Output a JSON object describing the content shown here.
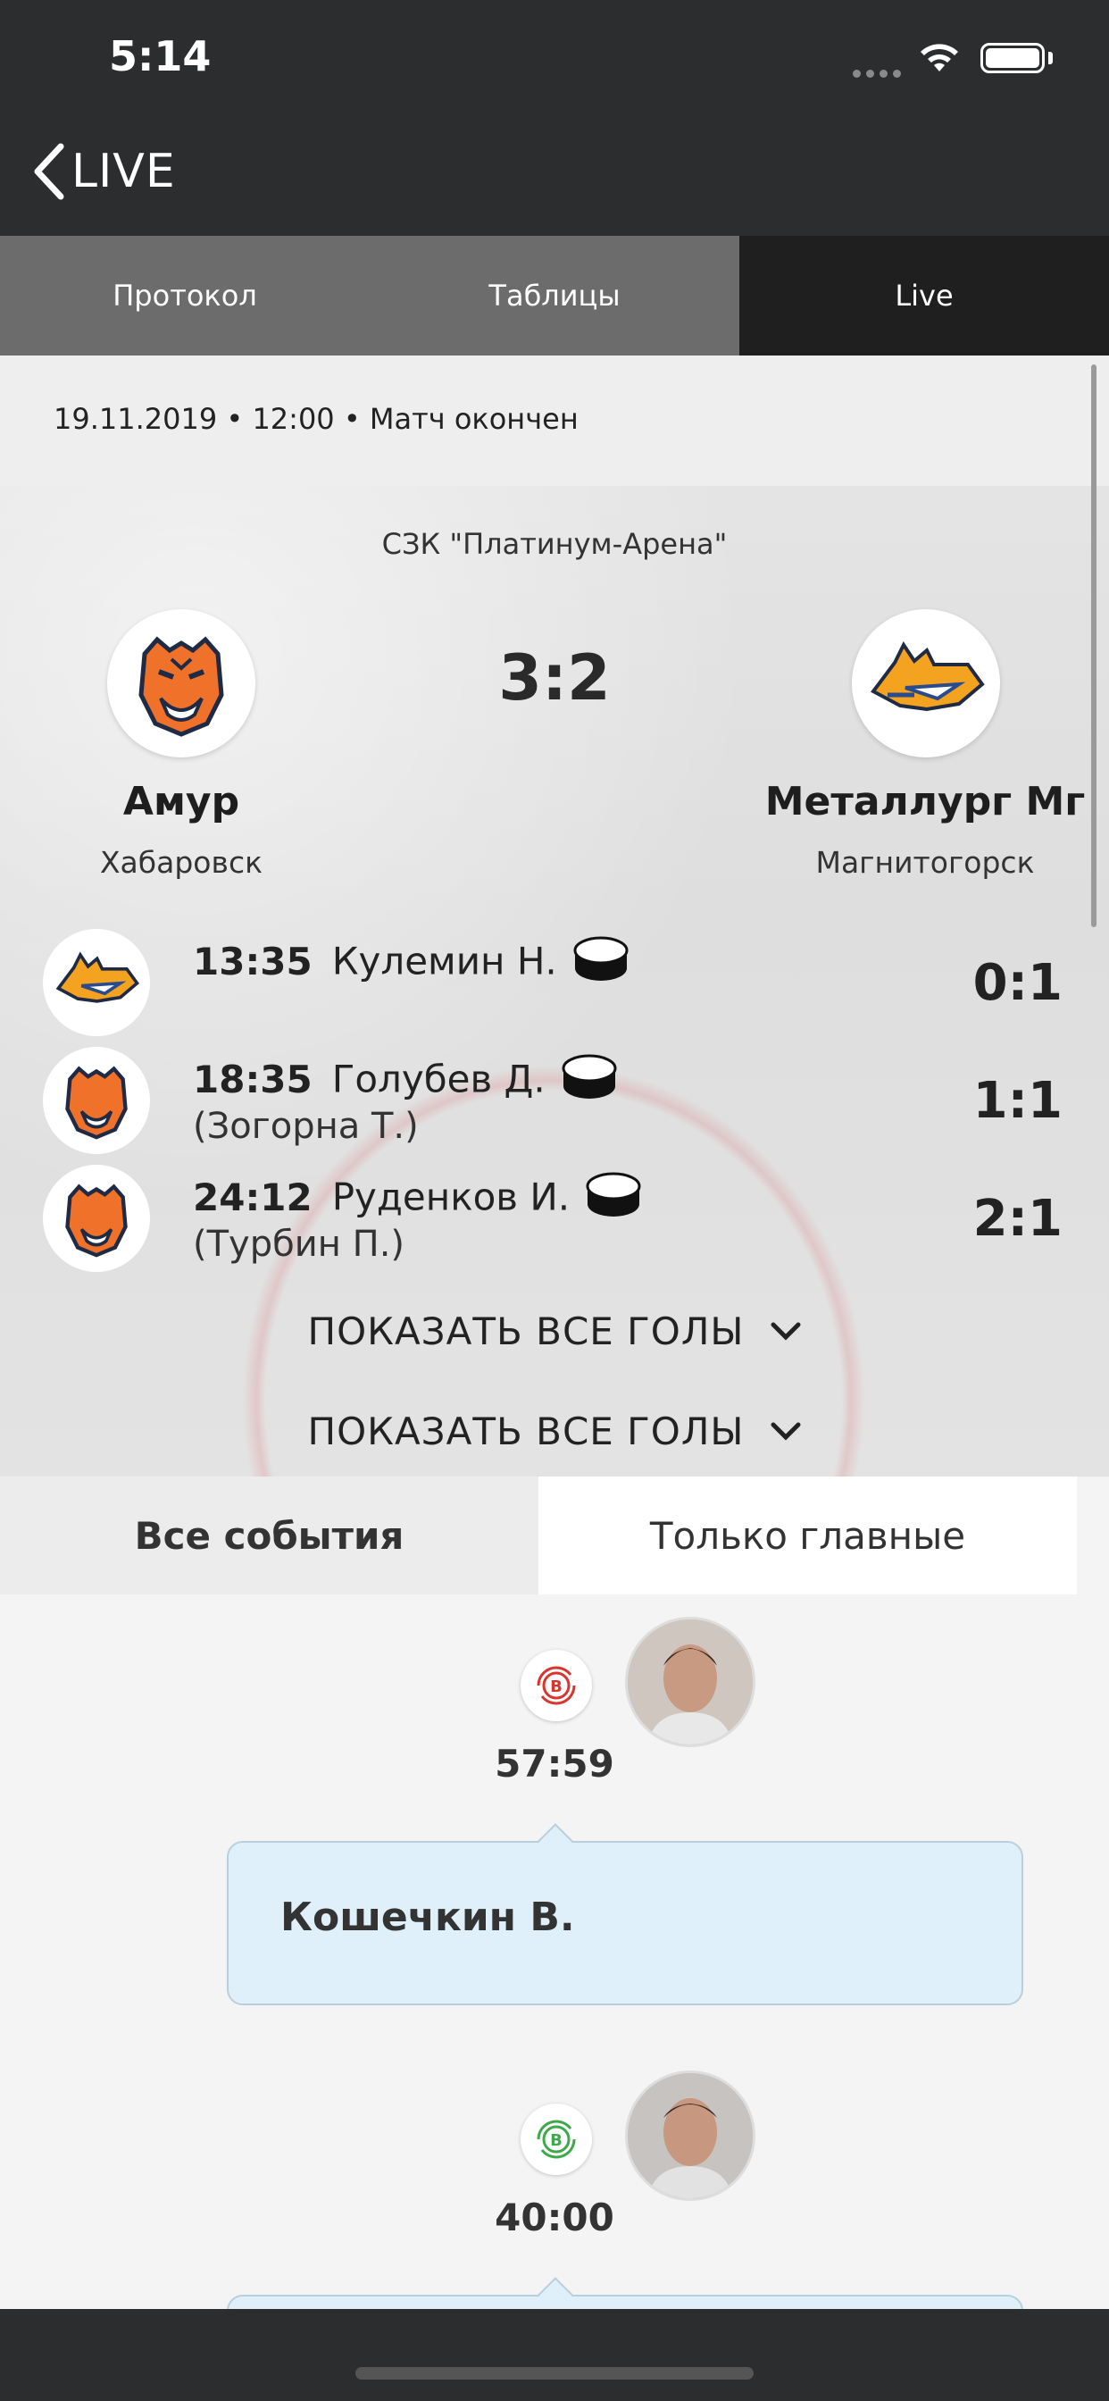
{
  "status_bar": {
    "time": "5:14"
  },
  "nav": {
    "back_label": "LIVE"
  },
  "tabs": [
    {
      "label": "Протокол",
      "active": false
    },
    {
      "label": "Таблицы",
      "active": false
    },
    {
      "label": "Live",
      "active": true
    }
  ],
  "match": {
    "date_line": "19.11.2019 • 12:00 •  Матч окончен",
    "venue": "СЗК \"Платинум-Арена\"",
    "score": "3:2",
    "home": {
      "name": "Амур",
      "city": "Хабаровск",
      "logo": "tiger-logo"
    },
    "away": {
      "name": "Металлург Мг",
      "city": "Магнитогорск",
      "logo": "wolf-logo"
    }
  },
  "goals": [
    {
      "time": "13:35",
      "player": "Кулемин Н.",
      "assist": "",
      "score": "0:1",
      "team_logo": "wolf-logo"
    },
    {
      "time": "18:35",
      "player": "Голубев Д.",
      "assist": "(Зогорна Т.)",
      "score": "1:1",
      "team_logo": "tiger-logo"
    },
    {
      "time": "24:12",
      "player": "Руденков И.",
      "assist": "(Турбин П.)",
      "score": "2:1",
      "team_logo": "tiger-logo"
    }
  ],
  "show_all": [
    "ПОКАЗАТЬ ВСЕ ГОЛЫ",
    "ПОКАЗАТЬ ВСЕ ГОЛЫ"
  ],
  "event_tabs": {
    "all": "Все события",
    "main": "Только главные"
  },
  "events": [
    {
      "icon_letter": "В",
      "icon_color": "#d9352e",
      "time": "57:59",
      "text": "Кошечкин В."
    },
    {
      "icon_letter": "В",
      "icon_color": "#3daa4a",
      "time": "40:00",
      "text": ""
    }
  ],
  "colors": {
    "nav_bg": "#2b2d2f",
    "tab_inactive": "#6c6c6c",
    "tab_active": "#1f1f20",
    "bubble_bg": "#dff0fa"
  }
}
